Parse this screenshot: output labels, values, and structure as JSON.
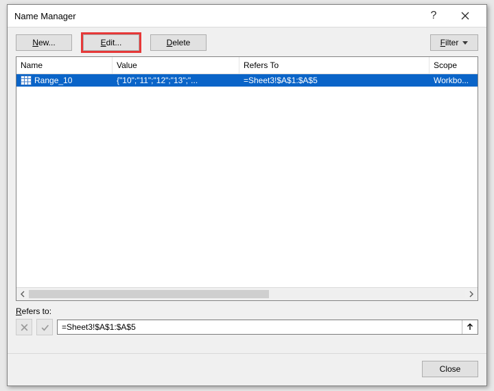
{
  "titlebar": {
    "title": "Name Manager"
  },
  "toolbar": {
    "new_label": "New...",
    "new_key": "N",
    "edit_label": "Edit...",
    "edit_key": "E",
    "delete_label": "Delete",
    "delete_key": "D",
    "filter_label": "Filter",
    "filter_key": "F"
  },
  "columns": {
    "name": "Name",
    "value": "Value",
    "refers": "Refers To",
    "scope": "Scope"
  },
  "rows": [
    {
      "name": "Range_10",
      "value": "{\"10\";\"11\";\"12\";\"13\";\"...",
      "refers": "=Sheet3!$A$1:$A$5",
      "scope": "Workbo...",
      "selected": true
    }
  ],
  "refers_to": {
    "label": "Refers to:",
    "value": "=Sheet3!$A$1:$A$5"
  },
  "footer": {
    "close_label": "Close"
  }
}
